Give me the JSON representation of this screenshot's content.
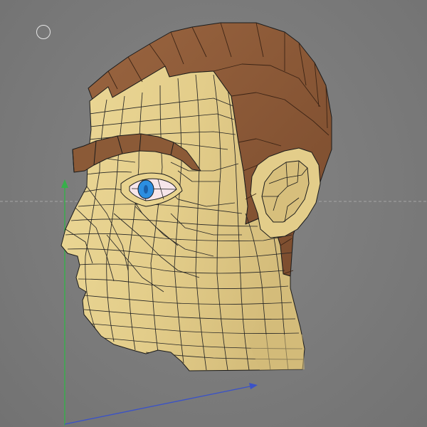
{
  "viewport": {
    "background": "#7b7b7b",
    "horizon_line_color": "#a4a4a4"
  },
  "gizmo": {
    "icon": "navigation-circle-icon",
    "color": "#e6e6e6"
  },
  "axes": {
    "y_axis_color": "#36b04a",
    "x_axis_color": "#3a52c8"
  },
  "model": {
    "type": "low-poly-head",
    "skin_color": "#e5d08e",
    "skin_shadow_color": "#cdb574",
    "hair_color": "#8b5a37",
    "hair_shadow_color": "#6f4426",
    "eyebrow_color": "#8b5a37",
    "iris_color": "#2c8ee0",
    "eye_white_color": "#f7e6ea",
    "wire_color": "#1b1b1b"
  }
}
